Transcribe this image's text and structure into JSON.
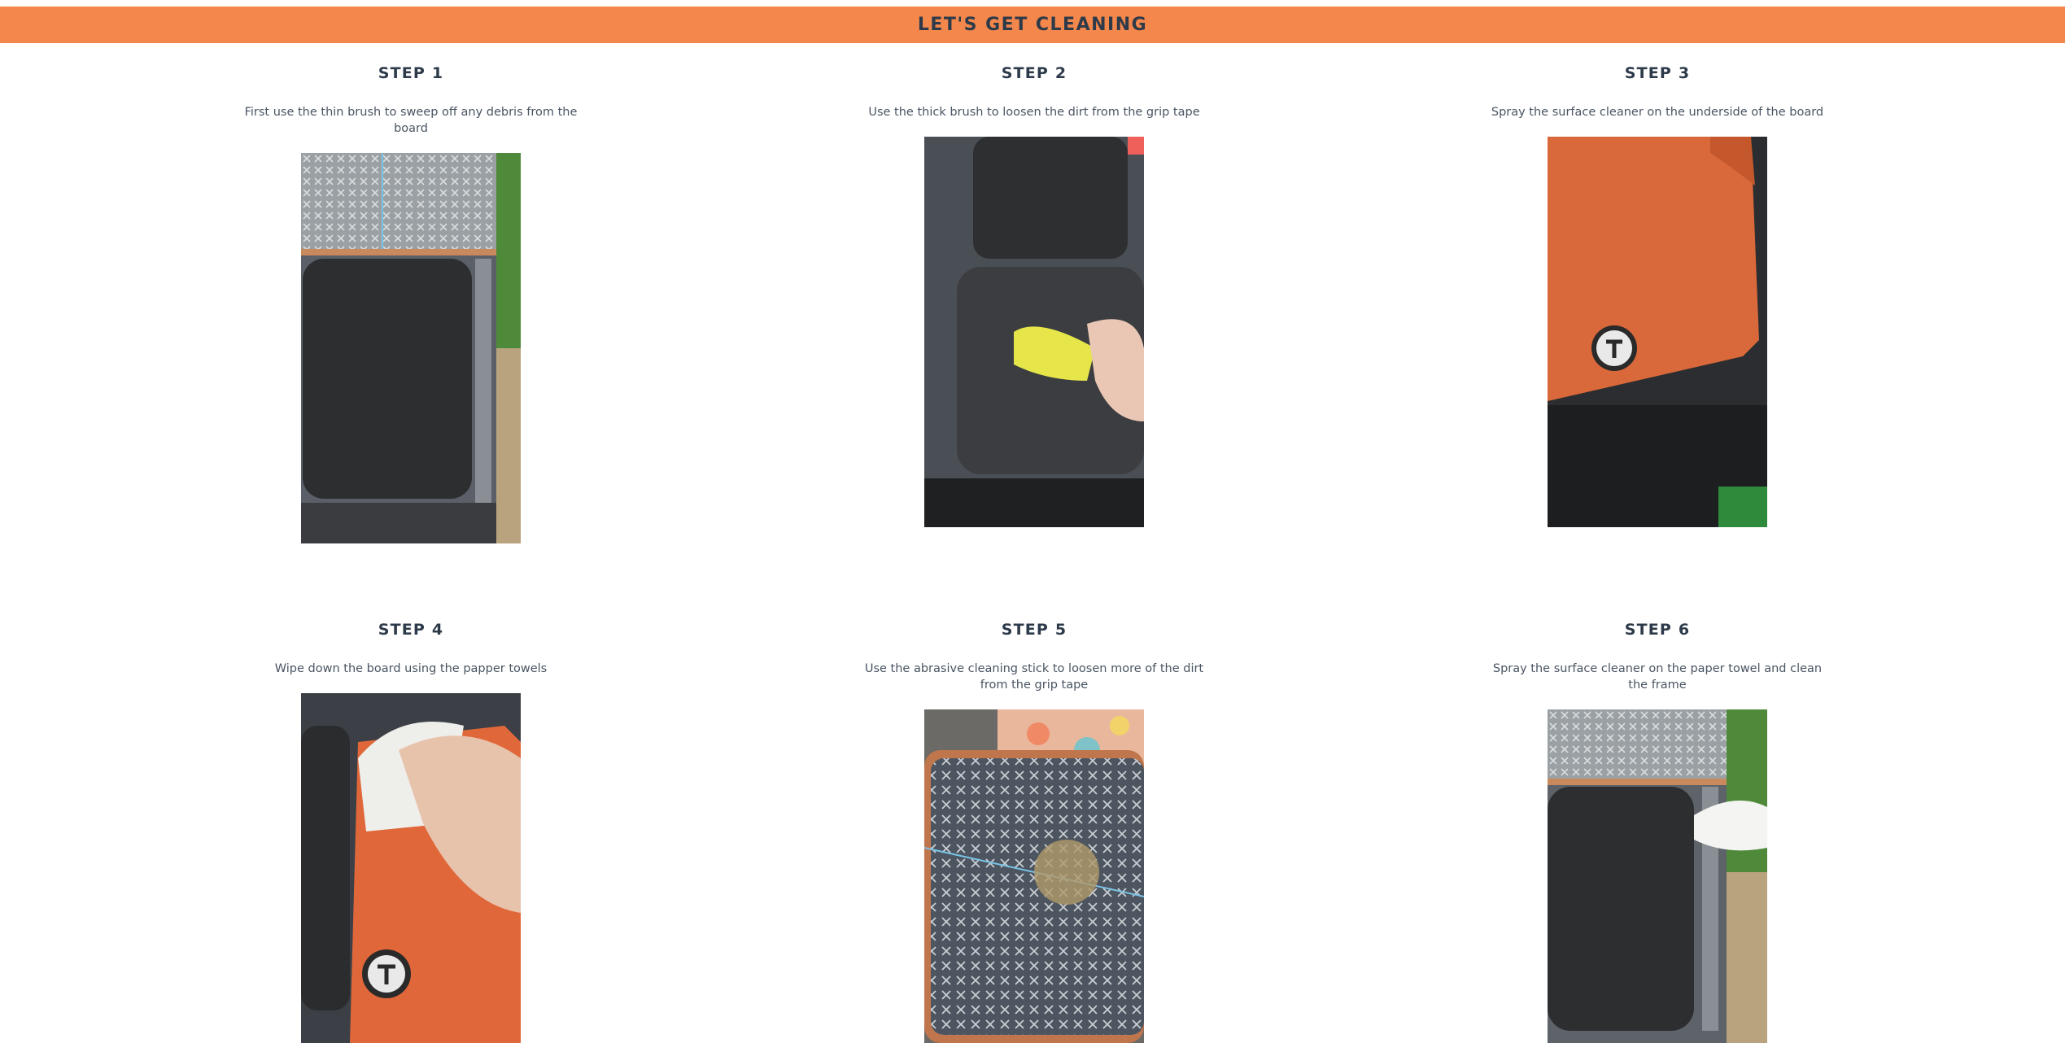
{
  "header": {
    "title": "LET'S GET CLEANING"
  },
  "steps": [
    {
      "title": "STEP 1",
      "text": "First use the thin brush to sweep off any debris from the board",
      "image": "step-1-photo"
    },
    {
      "title": "STEP 2",
      "text": "Use the thick brush to loosen the dirt from the grip tape",
      "image": "step-2-photo"
    },
    {
      "title": "STEP 3",
      "text": "Spray the surface cleaner on the underside of the board",
      "image": "step-3-photo"
    },
    {
      "title": "STEP 4",
      "text": "Wipe down the board using the papper towels",
      "image": "step-4-photo"
    },
    {
      "title": "STEP 5",
      "text": "Use the abrasive cleaning stick to loosen more of the dirt from the grip tape",
      "image": "step-5-photo"
    },
    {
      "title": "STEP 6",
      "text": "Spray the surface cleaner on the paper towel and clean the frame",
      "image": "step-6-photo"
    }
  ],
  "colors": {
    "banner": "#f4874b",
    "heading": "#2d3a4a",
    "body_text": "#4a5563"
  }
}
